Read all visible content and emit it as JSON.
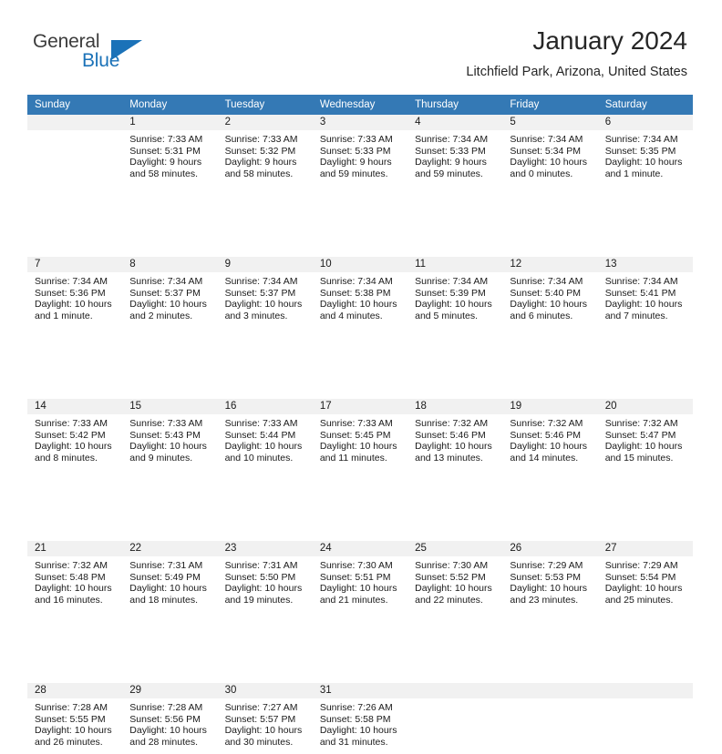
{
  "brand": {
    "name_part1": "General",
    "name_part2": "Blue",
    "accent_color": "#1b72b8"
  },
  "header": {
    "title": "January 2024",
    "location": "Litchfield Park, Arizona, United States"
  },
  "calendar": {
    "header_bg": "#3479b5",
    "daynum_bg": "#f1f1f1",
    "columns": [
      "Sunday",
      "Monday",
      "Tuesday",
      "Wednesday",
      "Thursday",
      "Friday",
      "Saturday"
    ],
    "weeks": [
      [
        {
          "day": "",
          "sunrise": "",
          "sunset": "",
          "daylight_line1": "",
          "daylight_line2": ""
        },
        {
          "day": "1",
          "sunrise": "Sunrise: 7:33 AM",
          "sunset": "Sunset: 5:31 PM",
          "daylight_line1": "Daylight: 9 hours",
          "daylight_line2": "and 58 minutes."
        },
        {
          "day": "2",
          "sunrise": "Sunrise: 7:33 AM",
          "sunset": "Sunset: 5:32 PM",
          "daylight_line1": "Daylight: 9 hours",
          "daylight_line2": "and 58 minutes."
        },
        {
          "day": "3",
          "sunrise": "Sunrise: 7:33 AM",
          "sunset": "Sunset: 5:33 PM",
          "daylight_line1": "Daylight: 9 hours",
          "daylight_line2": "and 59 minutes."
        },
        {
          "day": "4",
          "sunrise": "Sunrise: 7:34 AM",
          "sunset": "Sunset: 5:33 PM",
          "daylight_line1": "Daylight: 9 hours",
          "daylight_line2": "and 59 minutes."
        },
        {
          "day": "5",
          "sunrise": "Sunrise: 7:34 AM",
          "sunset": "Sunset: 5:34 PM",
          "daylight_line1": "Daylight: 10 hours",
          "daylight_line2": "and 0 minutes."
        },
        {
          "day": "6",
          "sunrise": "Sunrise: 7:34 AM",
          "sunset": "Sunset: 5:35 PM",
          "daylight_line1": "Daylight: 10 hours",
          "daylight_line2": "and 1 minute."
        }
      ],
      [
        {
          "day": "7",
          "sunrise": "Sunrise: 7:34 AM",
          "sunset": "Sunset: 5:36 PM",
          "daylight_line1": "Daylight: 10 hours",
          "daylight_line2": "and 1 minute."
        },
        {
          "day": "8",
          "sunrise": "Sunrise: 7:34 AM",
          "sunset": "Sunset: 5:37 PM",
          "daylight_line1": "Daylight: 10 hours",
          "daylight_line2": "and 2 minutes."
        },
        {
          "day": "9",
          "sunrise": "Sunrise: 7:34 AM",
          "sunset": "Sunset: 5:37 PM",
          "daylight_line1": "Daylight: 10 hours",
          "daylight_line2": "and 3 minutes."
        },
        {
          "day": "10",
          "sunrise": "Sunrise: 7:34 AM",
          "sunset": "Sunset: 5:38 PM",
          "daylight_line1": "Daylight: 10 hours",
          "daylight_line2": "and 4 minutes."
        },
        {
          "day": "11",
          "sunrise": "Sunrise: 7:34 AM",
          "sunset": "Sunset: 5:39 PM",
          "daylight_line1": "Daylight: 10 hours",
          "daylight_line2": "and 5 minutes."
        },
        {
          "day": "12",
          "sunrise": "Sunrise: 7:34 AM",
          "sunset": "Sunset: 5:40 PM",
          "daylight_line1": "Daylight: 10 hours",
          "daylight_line2": "and 6 minutes."
        },
        {
          "day": "13",
          "sunrise": "Sunrise: 7:34 AM",
          "sunset": "Sunset: 5:41 PM",
          "daylight_line1": "Daylight: 10 hours",
          "daylight_line2": "and 7 minutes."
        }
      ],
      [
        {
          "day": "14",
          "sunrise": "Sunrise: 7:33 AM",
          "sunset": "Sunset: 5:42 PM",
          "daylight_line1": "Daylight: 10 hours",
          "daylight_line2": "and 8 minutes."
        },
        {
          "day": "15",
          "sunrise": "Sunrise: 7:33 AM",
          "sunset": "Sunset: 5:43 PM",
          "daylight_line1": "Daylight: 10 hours",
          "daylight_line2": "and 9 minutes."
        },
        {
          "day": "16",
          "sunrise": "Sunrise: 7:33 AM",
          "sunset": "Sunset: 5:44 PM",
          "daylight_line1": "Daylight: 10 hours",
          "daylight_line2": "and 10 minutes."
        },
        {
          "day": "17",
          "sunrise": "Sunrise: 7:33 AM",
          "sunset": "Sunset: 5:45 PM",
          "daylight_line1": "Daylight: 10 hours",
          "daylight_line2": "and 11 minutes."
        },
        {
          "day": "18",
          "sunrise": "Sunrise: 7:32 AM",
          "sunset": "Sunset: 5:46 PM",
          "daylight_line1": "Daylight: 10 hours",
          "daylight_line2": "and 13 minutes."
        },
        {
          "day": "19",
          "sunrise": "Sunrise: 7:32 AM",
          "sunset": "Sunset: 5:46 PM",
          "daylight_line1": "Daylight: 10 hours",
          "daylight_line2": "and 14 minutes."
        },
        {
          "day": "20",
          "sunrise": "Sunrise: 7:32 AM",
          "sunset": "Sunset: 5:47 PM",
          "daylight_line1": "Daylight: 10 hours",
          "daylight_line2": "and 15 minutes."
        }
      ],
      [
        {
          "day": "21",
          "sunrise": "Sunrise: 7:32 AM",
          "sunset": "Sunset: 5:48 PM",
          "daylight_line1": "Daylight: 10 hours",
          "daylight_line2": "and 16 minutes."
        },
        {
          "day": "22",
          "sunrise": "Sunrise: 7:31 AM",
          "sunset": "Sunset: 5:49 PM",
          "daylight_line1": "Daylight: 10 hours",
          "daylight_line2": "and 18 minutes."
        },
        {
          "day": "23",
          "sunrise": "Sunrise: 7:31 AM",
          "sunset": "Sunset: 5:50 PM",
          "daylight_line1": "Daylight: 10 hours",
          "daylight_line2": "and 19 minutes."
        },
        {
          "day": "24",
          "sunrise": "Sunrise: 7:30 AM",
          "sunset": "Sunset: 5:51 PM",
          "daylight_line1": "Daylight: 10 hours",
          "daylight_line2": "and 21 minutes."
        },
        {
          "day": "25",
          "sunrise": "Sunrise: 7:30 AM",
          "sunset": "Sunset: 5:52 PM",
          "daylight_line1": "Daylight: 10 hours",
          "daylight_line2": "and 22 minutes."
        },
        {
          "day": "26",
          "sunrise": "Sunrise: 7:29 AM",
          "sunset": "Sunset: 5:53 PM",
          "daylight_line1": "Daylight: 10 hours",
          "daylight_line2": "and 23 minutes."
        },
        {
          "day": "27",
          "sunrise": "Sunrise: 7:29 AM",
          "sunset": "Sunset: 5:54 PM",
          "daylight_line1": "Daylight: 10 hours",
          "daylight_line2": "and 25 minutes."
        }
      ],
      [
        {
          "day": "28",
          "sunrise": "Sunrise: 7:28 AM",
          "sunset": "Sunset: 5:55 PM",
          "daylight_line1": "Daylight: 10 hours",
          "daylight_line2": "and 26 minutes."
        },
        {
          "day": "29",
          "sunrise": "Sunrise: 7:28 AM",
          "sunset": "Sunset: 5:56 PM",
          "daylight_line1": "Daylight: 10 hours",
          "daylight_line2": "and 28 minutes."
        },
        {
          "day": "30",
          "sunrise": "Sunrise: 7:27 AM",
          "sunset": "Sunset: 5:57 PM",
          "daylight_line1": "Daylight: 10 hours",
          "daylight_line2": "and 30 minutes."
        },
        {
          "day": "31",
          "sunrise": "Sunrise: 7:26 AM",
          "sunset": "Sunset: 5:58 PM",
          "daylight_line1": "Daylight: 10 hours",
          "daylight_line2": "and 31 minutes."
        },
        {
          "day": "",
          "sunrise": "",
          "sunset": "",
          "daylight_line1": "",
          "daylight_line2": ""
        },
        {
          "day": "",
          "sunrise": "",
          "sunset": "",
          "daylight_line1": "",
          "daylight_line2": ""
        },
        {
          "day": "",
          "sunrise": "",
          "sunset": "",
          "daylight_line1": "",
          "daylight_line2": ""
        }
      ]
    ]
  }
}
